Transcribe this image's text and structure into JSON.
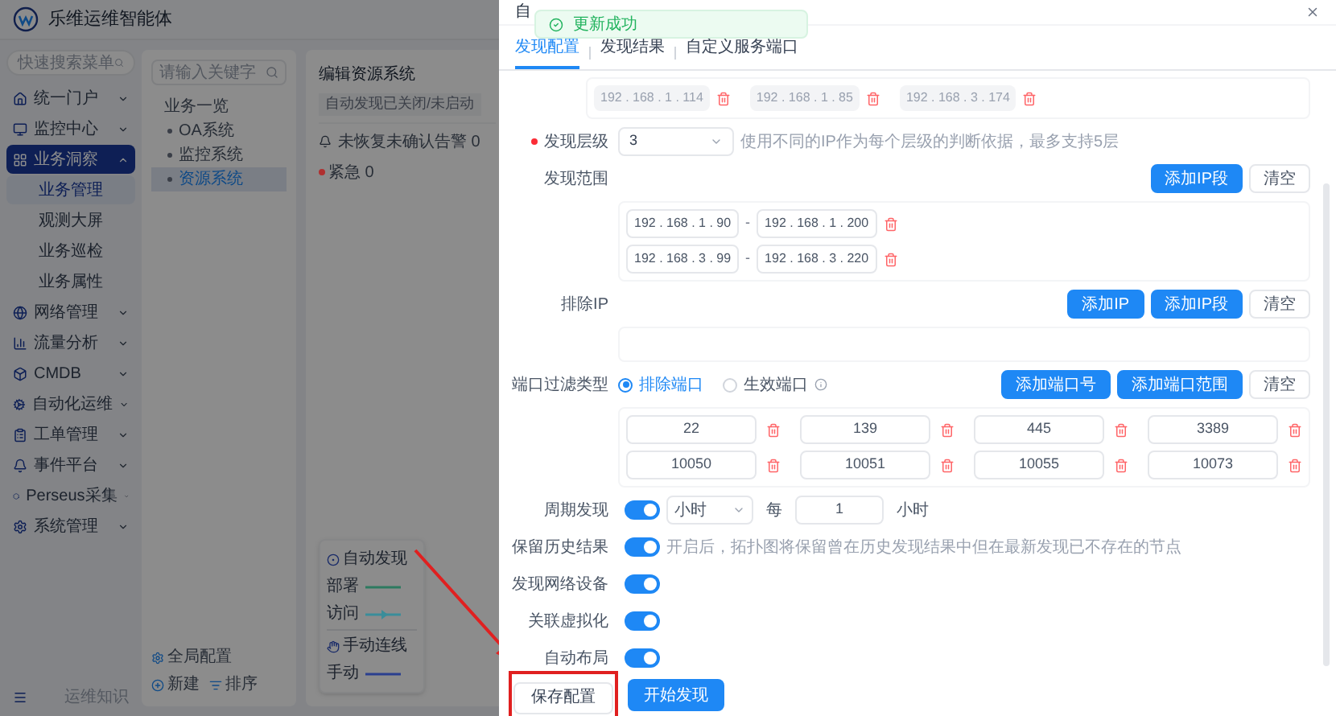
{
  "app": {
    "logo_text": "乐维运维智能体"
  },
  "sidebar": {
    "search": {
      "placeholder": "快速搜索菜单"
    },
    "items": [
      {
        "label": "统一门户",
        "expanded": false,
        "selected": false
      },
      {
        "label": "监控中心",
        "expanded": false,
        "selected": false
      },
      {
        "label": "业务洞察",
        "expanded": true,
        "selected": true,
        "children": [
          {
            "label": "业务管理",
            "selected": true
          },
          {
            "label": "观测大屏",
            "selected": false
          },
          {
            "label": "业务巡检",
            "selected": false
          },
          {
            "label": "业务属性",
            "selected": false
          }
        ]
      },
      {
        "label": "网络管理",
        "expanded": false,
        "selected": false
      },
      {
        "label": "流量分析",
        "expanded": false,
        "selected": false
      },
      {
        "label": "CMDB",
        "expanded": false,
        "selected": false
      },
      {
        "label": "自动化运维",
        "expanded": false,
        "selected": false
      },
      {
        "label": "工单管理",
        "expanded": false,
        "selected": false
      },
      {
        "label": "事件平台",
        "expanded": false,
        "selected": false
      },
      {
        "label": "Perseus采集",
        "expanded": false,
        "selected": false
      },
      {
        "label": "系统管理",
        "expanded": false,
        "selected": false
      }
    ],
    "footer_link": "运维知识"
  },
  "tree_panel": {
    "search": {
      "placeholder": "请输入关键字"
    },
    "root": "业务一览",
    "items": [
      {
        "label": "OA系统",
        "selected": false
      },
      {
        "label": "监控系统",
        "selected": false
      },
      {
        "label": "资源系统",
        "selected": true
      }
    ],
    "actions": [
      "全局配置",
      "新建",
      "排序"
    ]
  },
  "main_panel": {
    "title": "编辑资源系统",
    "tag": "自动发现已关闭/未启动",
    "alerts": [
      {
        "label": "未恢复未确认告警 0"
      },
      {
        "label": "紧急 0",
        "color": "#b03030"
      }
    ],
    "legend": [
      {
        "title": "自动发现",
        "lines": [
          {
            "label": "部署",
            "color": "#2d7a60",
            "kind": "solid"
          },
          {
            "label": "访问",
            "color": "#3a8d9a",
            "kind": "arrow"
          }
        ]
      },
      {
        "title": "手动连线",
        "lines": [
          {
            "label": "手动",
            "color": "#2a3f8f",
            "kind": "solid"
          }
        ]
      }
    ]
  },
  "modal": {
    "title": "自",
    "toast": {
      "text": "更新成功"
    },
    "tabs": [
      {
        "label": "发现配置",
        "selected": true
      },
      {
        "label": "发现结果",
        "selected": false
      },
      {
        "label": "自定义服务端口",
        "selected": false
      }
    ],
    "top_ips": [
      "192 . 168 . 1 . 114",
      "192 . 168 . 1 . 85",
      "192 . 168 . 3 . 174"
    ],
    "level": {
      "label": "发现层级",
      "required": true,
      "value": "3",
      "hint": "使用不同的IP作为每个层级的判断依据，最多支持5层"
    },
    "range": {
      "label": "发现范围",
      "buttons": [
        {
          "label": "添加IP段",
          "kind": "primary"
        },
        {
          "label": "清空",
          "kind": "default"
        }
      ],
      "separator": "-",
      "rows": [
        {
          "from": "192 . 168 . 1 . 90",
          "to": "192 . 168 . 1 . 200"
        },
        {
          "from": "192 . 168 . 3 . 99",
          "to": "192 . 168 . 3 . 220"
        }
      ]
    },
    "exclude": {
      "label": "排除IP",
      "buttons": [
        {
          "label": "添加IP",
          "kind": "primary"
        },
        {
          "label": "添加IP段",
          "kind": "primary"
        },
        {
          "label": "清空",
          "kind": "default"
        }
      ]
    },
    "port_filter": {
      "label": "端口过滤类型",
      "options": [
        {
          "label": "排除端口",
          "selected": true
        },
        {
          "label": "生效端口",
          "selected": false
        }
      ],
      "buttons": [
        {
          "label": "添加端口号",
          "kind": "primary"
        },
        {
          "label": "添加端口范围",
          "kind": "primary"
        },
        {
          "label": "清空",
          "kind": "default"
        }
      ],
      "ports": [
        "22",
        "139",
        "445",
        "3389",
        "10050",
        "10051",
        "10055",
        "10073"
      ]
    },
    "period": {
      "label": "周期发现",
      "on": true,
      "unit": "小时",
      "every": "每",
      "value": "1",
      "suffix": "小时"
    },
    "switches": [
      {
        "label": "保留历史结果",
        "on": true,
        "hint": "开启后，拓扑图将保留曾在历史发现结果中但在最新发现已不存在的节点"
      },
      {
        "label": "发现网络设备",
        "on": true
      },
      {
        "label": "关联虚拟化",
        "on": true
      },
      {
        "label": "自动布局",
        "on": true
      }
    ],
    "footer": [
      {
        "label": "保存配置",
        "kind": "default",
        "highlighted": true
      },
      {
        "label": "开始发现",
        "kind": "primary",
        "highlighted": false
      }
    ]
  }
}
